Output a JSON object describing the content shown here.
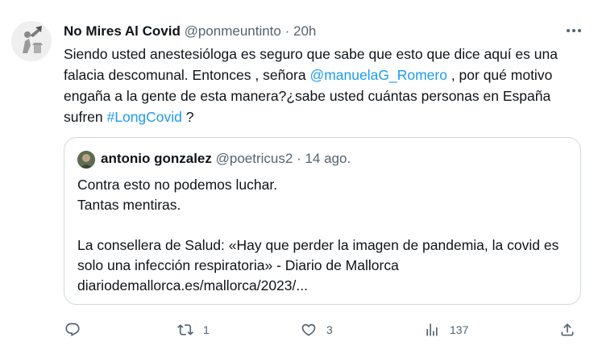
{
  "tweet": {
    "author_name": "No Mires Al Covid",
    "author_handle": "@ponmeuntinto",
    "separator": "·",
    "time": "20h",
    "more_icon": "more-horizontal-icon",
    "text_part1": "Siendo usted anestesióloga es seguro que sabe que esto que dice aquí es una falacia descomunal. Entonces , señora ",
    "mention": "@manuelaG_Romero",
    "text_part2": " , por qué motivo engaña a la gente de esta manera?¿sabe usted cuántas personas en España sufren ",
    "hashtag": "#LongCovid",
    "text_part3": " ?"
  },
  "quote": {
    "author_name": "antonio gonzalez",
    "author_handle": "@poetricus2",
    "separator": "·",
    "date": "14 ago.",
    "line1": "Contra esto no podemos luchar.",
    "line2": "Tantas mentiras.",
    "line3": "La consellera de Salud: «Hay que perder la imagen de pandemia, la covid es solo una infección respiratoria» - Diario de Mallorca",
    "link": "diariodemallorca.es/mallorca/2023/..."
  },
  "actions": {
    "reply": {
      "icon": "reply-icon",
      "count": ""
    },
    "retweet": {
      "icon": "retweet-icon",
      "count": "1"
    },
    "like": {
      "icon": "heart-icon",
      "count": "3"
    },
    "views": {
      "icon": "views-icon",
      "count": "137"
    },
    "share": {
      "icon": "share-icon",
      "count": ""
    }
  }
}
